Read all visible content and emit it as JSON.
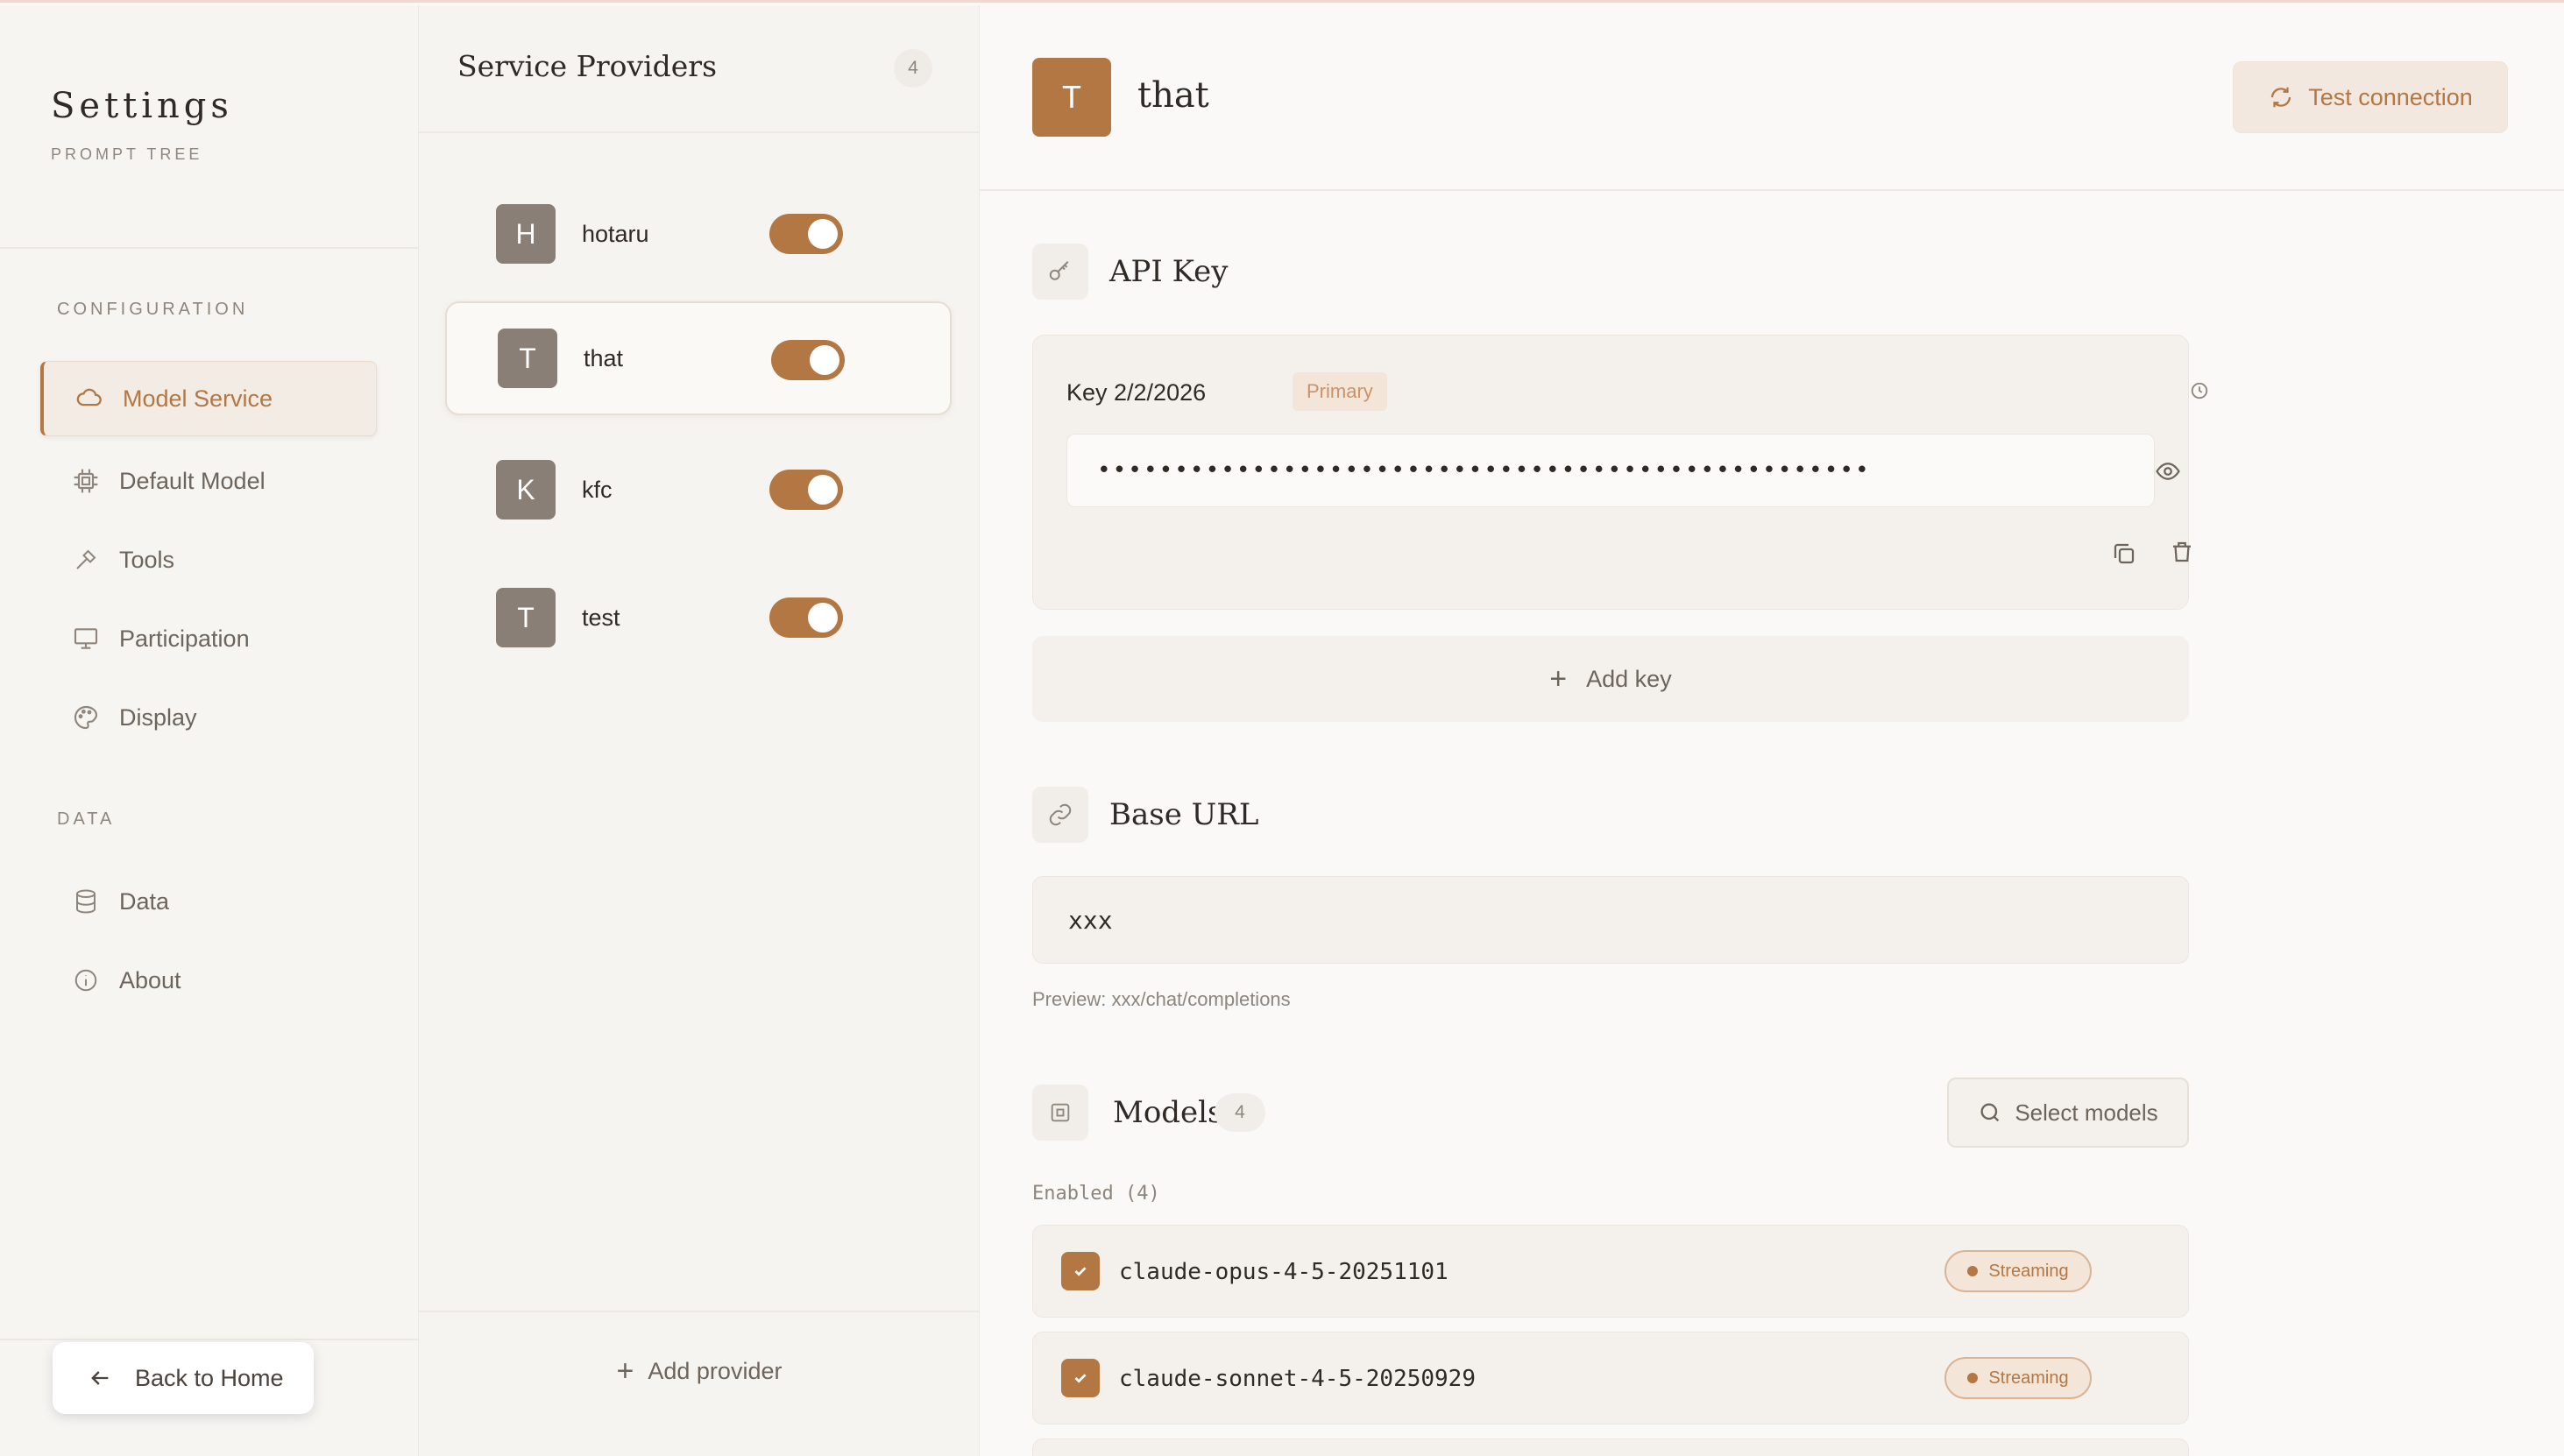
{
  "sidebar": {
    "title": "Settings",
    "subtitle": "PROMPT TREE",
    "section_configuration": "CONFIGURATION",
    "section_data": "DATA",
    "items": [
      {
        "label": "Model Service",
        "icon": "cloud-icon"
      },
      {
        "label": "Default Model",
        "icon": "chip-icon"
      },
      {
        "label": "Tools",
        "icon": "wrench-icon"
      },
      {
        "label": "Participation",
        "icon": "monitor-icon"
      },
      {
        "label": "Display",
        "icon": "palette-icon"
      }
    ],
    "data_items": [
      {
        "label": "Data",
        "icon": "database-icon"
      },
      {
        "label": "About",
        "icon": "info-icon"
      }
    ],
    "back_label": "Back to Home"
  },
  "providers": {
    "title": "Service Providers",
    "count": "4",
    "items": [
      {
        "initial": "H",
        "name": "hotaru",
        "enabled": true
      },
      {
        "initial": "T",
        "name": "that",
        "enabled": true
      },
      {
        "initial": "K",
        "name": "kfc",
        "enabled": true
      },
      {
        "initial": "T",
        "name": "test",
        "enabled": true
      }
    ],
    "add_label": "Add provider"
  },
  "main": {
    "avatar_initial": "T",
    "title": "that",
    "test_connection": "Test connection",
    "api_key": {
      "section_title": "API Key",
      "key_label": "Key 2/2/2026",
      "badge": "Primary",
      "masked_value": "••••••••••••••••••••••••••••••••••••••••••••••••••",
      "add_key_label": "Add key"
    },
    "base_url": {
      "section_title": "Base URL",
      "value": "xxx",
      "preview": "Preview: xxx/chat/completions"
    },
    "models": {
      "section_title": "Models",
      "count": "4",
      "select_label": "Select models",
      "enabled_label": "Enabled (4)",
      "items": [
        {
          "name": "claude-opus-4-5-20251101",
          "badge": "Streaming"
        },
        {
          "name": "claude-sonnet-4-5-20250929",
          "badge": "Streaming"
        }
      ]
    }
  },
  "colors": {
    "accent": "#b37744",
    "avatar_gray": "#8a7f76",
    "background": "#faf9f7"
  }
}
